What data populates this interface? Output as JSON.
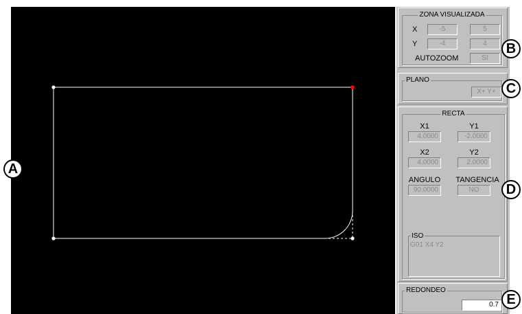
{
  "zona": {
    "title": "ZONA VISUALIZADA",
    "x_label": "X",
    "x_min": "-5",
    "x_max": "5",
    "y_label": "Y",
    "y_min": "-4",
    "y_max": "4",
    "autozoom_label": "AUTOZOOM",
    "autozoom_value": "SI"
  },
  "plano": {
    "title": "PLANO",
    "value": "X+ Y+"
  },
  "recta": {
    "title": "RECTA",
    "x1_label": "X1",
    "x1": "4.0000",
    "y1_label": "Y1",
    "y1": "-2.0000",
    "x2_label": "X2",
    "x2": "4.0000",
    "y2_label": "Y2",
    "y2": "2.0000",
    "angulo_label": "ANGULO",
    "angulo": "90.0000",
    "tangencia_label": "TANGENCIA",
    "tangencia": "NO",
    "iso_title": "ISO",
    "iso_code": "G01 X4 Y2"
  },
  "redondeo": {
    "title": "REDONDEO",
    "value": "0.7"
  },
  "callouts": {
    "a": "A",
    "b": "B",
    "c": "C",
    "d": "D",
    "e": "E"
  },
  "colors": {
    "canvas": "#000000",
    "contour": "#ffffff",
    "active_point": "#ff0000",
    "panel": "#c0c0c0"
  }
}
